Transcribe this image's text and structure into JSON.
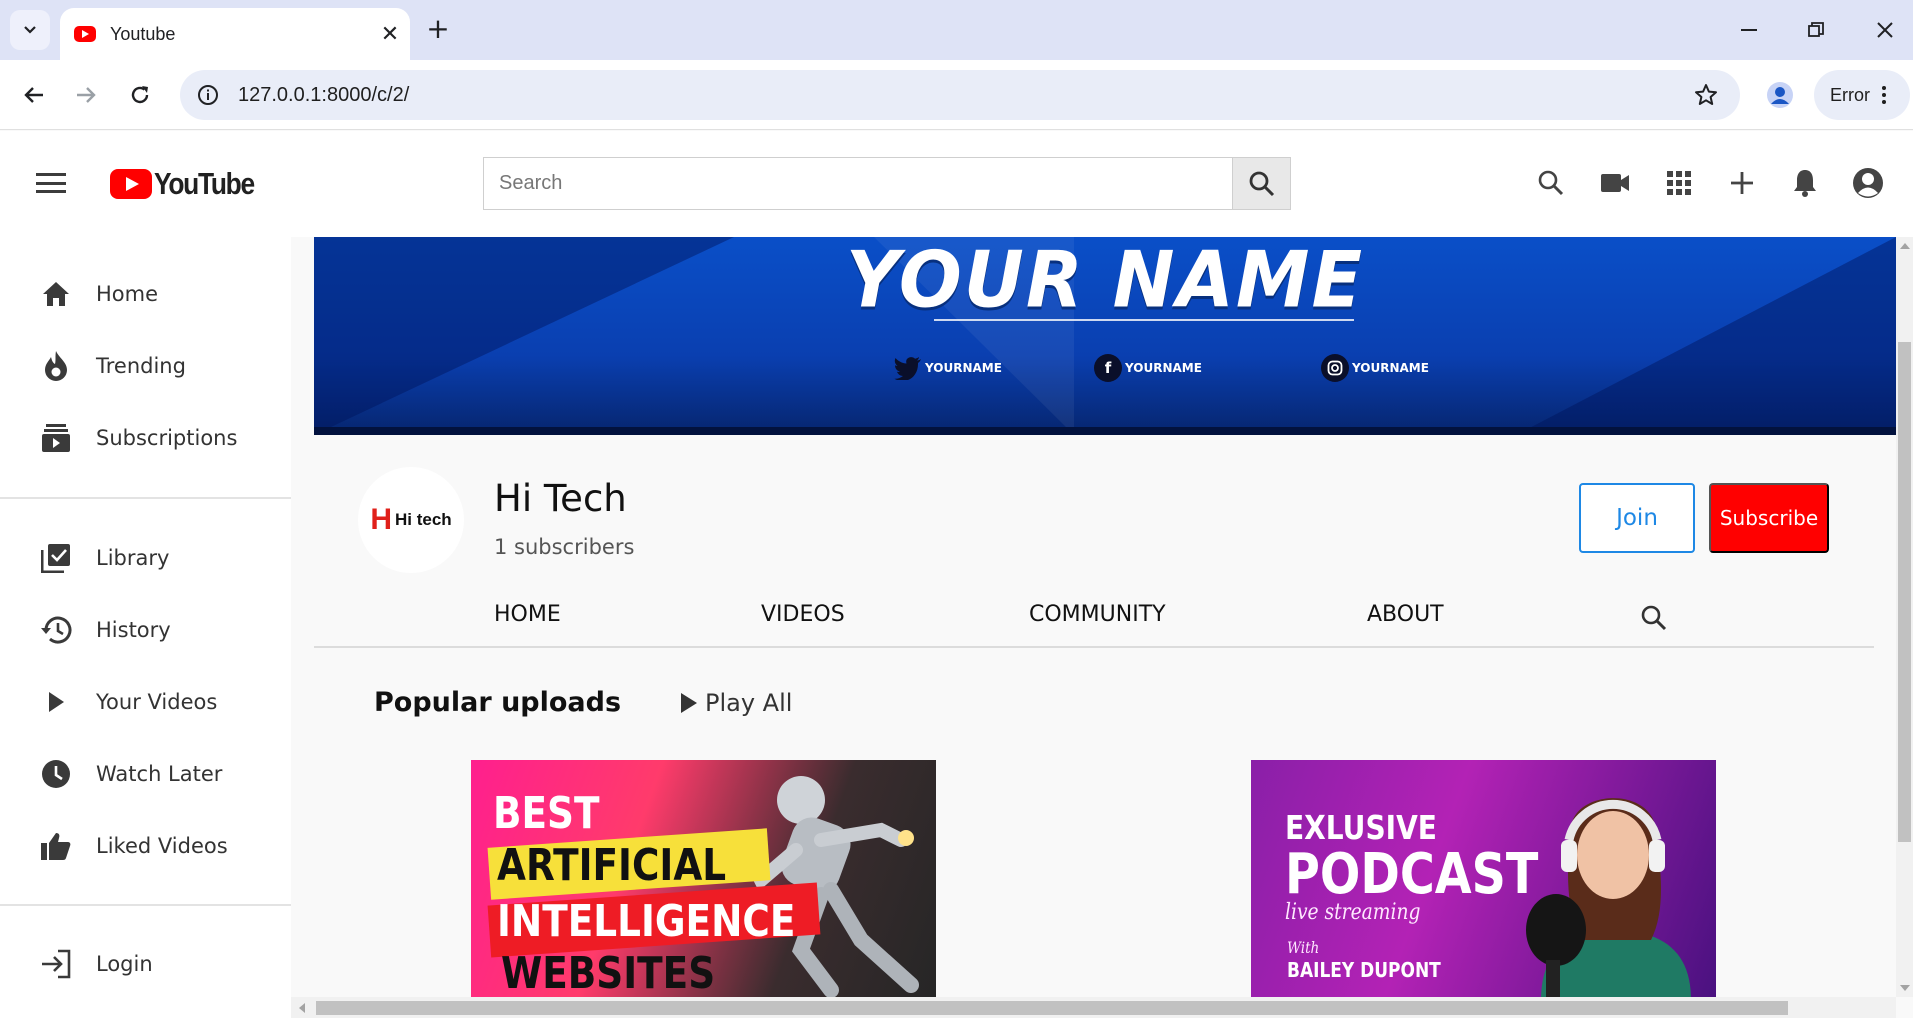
{
  "browser": {
    "tab_title": "Youtube",
    "url": "127.0.0.1:8000/c/2/",
    "profile_status": "Error"
  },
  "header": {
    "logo_text": "YouTube",
    "search_placeholder": "Search",
    "icons": [
      "search-icon",
      "video-camera-icon",
      "apps-grid-icon",
      "plus-icon",
      "bell-icon",
      "account-circle-icon"
    ]
  },
  "sidebar": {
    "primary": [
      {
        "label": "Home",
        "icon": "home-icon"
      },
      {
        "label": "Trending",
        "icon": "flame-icon"
      },
      {
        "label": "Subscriptions",
        "icon": "subscriptions-icon"
      }
    ],
    "library": [
      {
        "label": "Library",
        "icon": "library-icon"
      },
      {
        "label": "History",
        "icon": "history-icon"
      },
      {
        "label": "Your Videos",
        "icon": "play-icon"
      },
      {
        "label": "Watch Later",
        "icon": "clock-icon"
      },
      {
        "label": "Liked Videos",
        "icon": "thumbs-up-icon"
      }
    ],
    "login": {
      "label": "Login",
      "icon": "login-icon"
    }
  },
  "banner": {
    "title": "YOUR NAME",
    "socials": [
      {
        "icon": "twitter-icon",
        "handle": "YOURNAME"
      },
      {
        "icon": "facebook-icon",
        "handle": "YOURNAME"
      },
      {
        "icon": "instagram-icon",
        "handle": "YOURNAME"
      }
    ]
  },
  "channel": {
    "avatar_text": "Hi tech",
    "name": "Hi Tech",
    "subscribers": "1 subscribers",
    "join_label": "Join",
    "subscribe_label": "Subscribe",
    "tabs": [
      "HOME",
      "VIDEOS",
      "COMMUNITY",
      "ABOUT"
    ]
  },
  "popular": {
    "heading": "Popular uploads",
    "play_all": "Play All",
    "videos": [
      {
        "thumb_lines": [
          "BEST",
          "ARTIFICIAL",
          "INTELLIGENCE",
          "WEBSITES"
        ]
      },
      {
        "thumb_lines": [
          "EXLUSIVE",
          "PODCAST",
          "live streaming",
          "With",
          "BAILEY DUPONT"
        ]
      }
    ]
  },
  "colors": {
    "accent_red": "#ff0000",
    "join_blue": "#1e88e5",
    "banner_blue": "#0a4fc8"
  }
}
